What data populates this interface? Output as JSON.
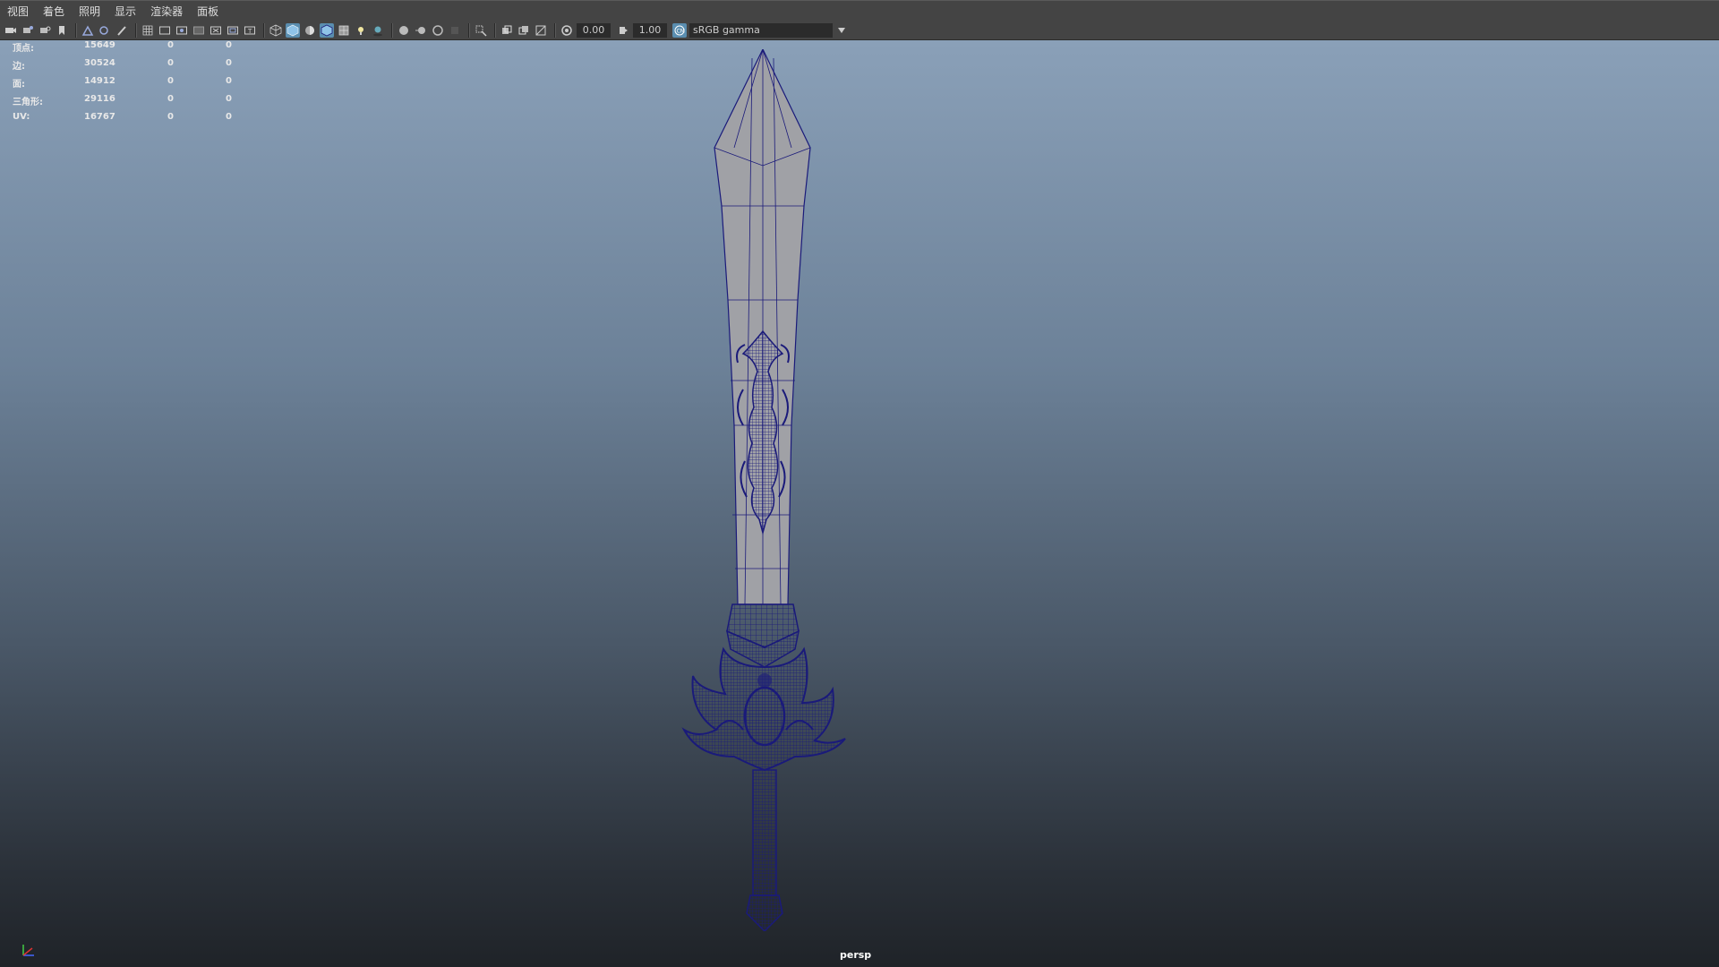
{
  "menu": {
    "items": [
      "视图",
      "着色",
      "照明",
      "显示",
      "渲染器",
      "面板"
    ]
  },
  "toolbar": {
    "exposure_value": "0.00",
    "gamma_value": "1.00",
    "color_space": "sRGB gamma",
    "accent_color": "#5a8eb0"
  },
  "hud": {
    "rows": [
      {
        "label": "顶点:",
        "total": "15649",
        "sel1": "0",
        "sel2": "0"
      },
      {
        "label": "边:",
        "total": "30524",
        "sel1": "0",
        "sel2": "0"
      },
      {
        "label": "面:",
        "total": "14912",
        "sel1": "0",
        "sel2": "0"
      },
      {
        "label": "三角形:",
        "total": "29116",
        "sel1": "0",
        "sel2": "0"
      },
      {
        "label": "UV:",
        "total": "16767",
        "sel1": "0",
        "sel2": "0"
      }
    ]
  },
  "viewport": {
    "camera": "persp",
    "wireframe_color": "#1a1a7a",
    "mesh_color": "#9a9ca2"
  }
}
